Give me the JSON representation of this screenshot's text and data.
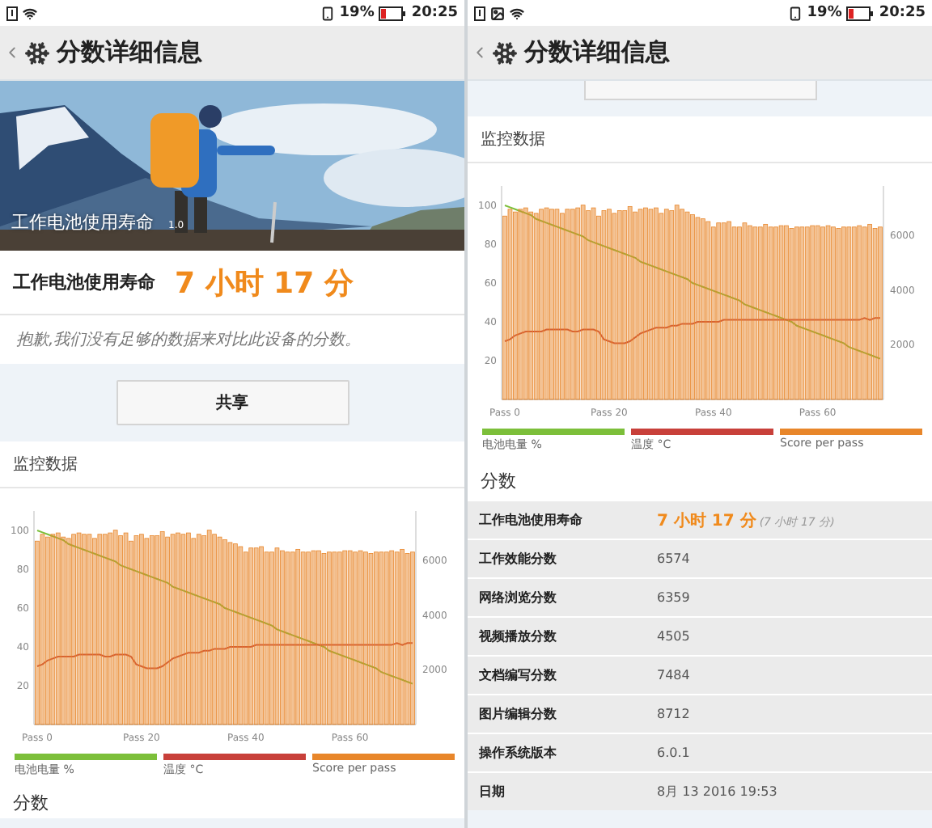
{
  "screens": [
    {
      "status_bar": {
        "battery": "19%",
        "time": "20:25",
        "gallery_notification": false
      },
      "title": "分数详细信息",
      "sections": [
        {
          "kind": "banner",
          "label": "工作电池使用寿命",
          "version": "1.0"
        },
        {
          "kind": "result",
          "label": "工作电池使用寿命",
          "value": "7 小时 17 分"
        },
        {
          "kind": "notice",
          "text": "抱歉,我们没有足够的数据来对比此设备的分数。"
        },
        {
          "kind": "share",
          "button": "共享"
        },
        {
          "kind": "monitor",
          "title": "监控数据",
          "chart_data": {
            "type": "bar",
            "categories": [
              "Pass 0",
              null,
              null,
              null,
              null,
              null,
              null,
              null,
              null,
              null,
              null,
              null,
              null,
              null,
              null,
              null,
              null,
              null,
              null,
              null,
              "Pass 20",
              null,
              null,
              null,
              null,
              null,
              null,
              null,
              null,
              null,
              null,
              null,
              null,
              null,
              null,
              null,
              null,
              null,
              null,
              null,
              "Pass 40",
              null,
              null,
              null,
              null,
              null,
              null,
              null,
              null,
              null,
              null,
              null,
              null,
              null,
              null,
              null,
              null,
              null,
              null,
              null,
              "Pass 60",
              null,
              null,
              null,
              null,
              null,
              null,
              null,
              null,
              null,
              null,
              null,
              null
            ],
            "ylim": [
              0,
              110
            ],
            "yticks": [
              20,
              40,
              60,
              80,
              100
            ],
            "y2lim": [
              0,
              7800
            ],
            "y2ticks": [
              2000,
              4000,
              6000
            ],
            "series": [
              {
                "name": "电池电量 %",
                "color": "#7cbf3a",
                "type": "line",
                "values": [
                  100,
                  99,
                  98,
                  97,
                  96,
                  95,
                  93,
                  92,
                  91,
                  90,
                  89,
                  88,
                  87,
                  86,
                  85,
                  84,
                  82,
                  81,
                  80,
                  79,
                  78,
                  77,
                  76,
                  75,
                  74,
                  73,
                  71,
                  70,
                  69,
                  68,
                  67,
                  66,
                  65,
                  64,
                  63,
                  62,
                  60,
                  59,
                  58,
                  57,
                  56,
                  55,
                  54,
                  53,
                  52,
                  51,
                  49,
                  48,
                  47,
                  46,
                  45,
                  44,
                  43,
                  42,
                  41,
                  40,
                  38,
                  37,
                  36,
                  35,
                  34,
                  33,
                  32,
                  31,
                  30,
                  29,
                  27,
                  26,
                  25,
                  24,
                  23,
                  22,
                  21
                ]
              },
              {
                "name": "温度 °C",
                "color": "#c8403a",
                "type": "line",
                "values": [
                  30,
                  31,
                  33,
                  34,
                  35,
                  35,
                  35,
                  35,
                  36,
                  36,
                  36,
                  36,
                  36,
                  35,
                  35,
                  36,
                  36,
                  36,
                  35,
                  31,
                  30,
                  29,
                  29,
                  29,
                  30,
                  32,
                  34,
                  35,
                  36,
                  37,
                  37,
                  37,
                  38,
                  38,
                  39,
                  39,
                  39,
                  40,
                  40,
                  40,
                  40,
                  40,
                  41,
                  41,
                  41,
                  41,
                  41,
                  41,
                  41,
                  41,
                  41,
                  41,
                  41,
                  41,
                  41,
                  41,
                  41,
                  41,
                  41,
                  41,
                  41,
                  41,
                  41,
                  41,
                  41,
                  41,
                  41,
                  41,
                  41,
                  42,
                  41,
                  42,
                  42
                ]
              },
              {
                "name": "Score per pass",
                "color": "#e8862a",
                "type": "bar",
                "axis": "y2",
                "values": [
                  6700,
                  6950,
                  6850,
                  6950,
                  7000,
                  6850,
                  6800,
                  6950,
                  7000,
                  6950,
                  6950,
                  6800,
                  6950,
                  6950,
                  7000,
                  7100,
                  6900,
                  7000,
                  6700,
                  6900,
                  6950,
                  6800,
                  6900,
                  6900,
                  7050,
                  6850,
                  6950,
                  7000,
                  6950,
                  7000,
                  6800,
                  6950,
                  6900,
                  7100,
                  6950,
                  6850,
                  6750,
                  6650,
                  6600,
                  6500,
                  6300,
                  6450,
                  6450,
                  6500,
                  6300,
                  6300,
                  6450,
                  6350,
                  6300,
                  6300,
                  6400,
                  6300,
                  6300,
                  6350,
                  6350,
                  6250,
                  6300,
                  6300,
                  6300,
                  6350,
                  6350,
                  6300,
                  6350,
                  6300,
                  6250,
                  6300,
                  6300,
                  6300,
                  6350,
                  6300,
                  6400,
                  6250,
                  6300
                ]
              }
            ]
          }
        },
        {
          "kind": "scores_heading",
          "text": "分数"
        }
      ]
    },
    {
      "status_bar": {
        "battery": "19%",
        "time": "20:25",
        "gallery_notification": true
      },
      "title": "分数详细信息",
      "sections": [
        {
          "kind": "partial_button"
        },
        {
          "kind": "monitor",
          "title": "监控数据",
          "chart_data": {
            "type": "bar",
            "categories": [
              "Pass 0",
              null,
              null,
              null,
              null,
              null,
              null,
              null,
              null,
              null,
              null,
              null,
              null,
              null,
              null,
              null,
              null,
              null,
              null,
              null,
              "Pass 20",
              null,
              null,
              null,
              null,
              null,
              null,
              null,
              null,
              null,
              null,
              null,
              null,
              null,
              null,
              null,
              null,
              null,
              null,
              null,
              "Pass 40",
              null,
              null,
              null,
              null,
              null,
              null,
              null,
              null,
              null,
              null,
              null,
              null,
              null,
              null,
              null,
              null,
              null,
              null,
              null,
              "Pass 60",
              null,
              null,
              null,
              null,
              null,
              null,
              null,
              null,
              null,
              null,
              null,
              null
            ],
            "ylim": [
              0,
              110
            ],
            "yticks": [
              20,
              40,
              60,
              80,
              100
            ],
            "y2lim": [
              0,
              7800
            ],
            "y2ticks": [
              2000,
              4000,
              6000
            ],
            "series": [
              {
                "name": "电池电量 %",
                "color": "#7cbf3a",
                "type": "line",
                "values": [
                  100,
                  99,
                  98,
                  97,
                  96,
                  95,
                  93,
                  92,
                  91,
                  90,
                  89,
                  88,
                  87,
                  86,
                  85,
                  84,
                  82,
                  81,
                  80,
                  79,
                  78,
                  77,
                  76,
                  75,
                  74,
                  73,
                  71,
                  70,
                  69,
                  68,
                  67,
                  66,
                  65,
                  64,
                  63,
                  62,
                  60,
                  59,
                  58,
                  57,
                  56,
                  55,
                  54,
                  53,
                  52,
                  51,
                  49,
                  48,
                  47,
                  46,
                  45,
                  44,
                  43,
                  42,
                  41,
                  40,
                  38,
                  37,
                  36,
                  35,
                  34,
                  33,
                  32,
                  31,
                  30,
                  29,
                  27,
                  26,
                  25,
                  24,
                  23,
                  22,
                  21
                ]
              },
              {
                "name": "温度 °C",
                "color": "#c8403a",
                "type": "line",
                "values": [
                  30,
                  31,
                  33,
                  34,
                  35,
                  35,
                  35,
                  35,
                  36,
                  36,
                  36,
                  36,
                  36,
                  35,
                  35,
                  36,
                  36,
                  36,
                  35,
                  31,
                  30,
                  29,
                  29,
                  29,
                  30,
                  32,
                  34,
                  35,
                  36,
                  37,
                  37,
                  37,
                  38,
                  38,
                  39,
                  39,
                  39,
                  40,
                  40,
                  40,
                  40,
                  40,
                  41,
                  41,
                  41,
                  41,
                  41,
                  41,
                  41,
                  41,
                  41,
                  41,
                  41,
                  41,
                  41,
                  41,
                  41,
                  41,
                  41,
                  41,
                  41,
                  41,
                  41,
                  41,
                  41,
                  41,
                  41,
                  41,
                  41,
                  42,
                  41,
                  42,
                  42
                ]
              },
              {
                "name": "Score per pass",
                "color": "#e8862a",
                "type": "bar",
                "axis": "y2",
                "values": [
                  6700,
                  6950,
                  6850,
                  6950,
                  7000,
                  6850,
                  6800,
                  6950,
                  7000,
                  6950,
                  6950,
                  6800,
                  6950,
                  6950,
                  7000,
                  7100,
                  6900,
                  7000,
                  6700,
                  6900,
                  6950,
                  6800,
                  6900,
                  6900,
                  7050,
                  6850,
                  6950,
                  7000,
                  6950,
                  7000,
                  6800,
                  6950,
                  6900,
                  7100,
                  6950,
                  6850,
                  6750,
                  6650,
                  6600,
                  6500,
                  6300,
                  6450,
                  6450,
                  6500,
                  6300,
                  6300,
                  6450,
                  6350,
                  6300,
                  6300,
                  6400,
                  6300,
                  6300,
                  6350,
                  6350,
                  6250,
                  6300,
                  6300,
                  6300,
                  6350,
                  6350,
                  6300,
                  6350,
                  6300,
                  6250,
                  6300,
                  6300,
                  6300,
                  6350,
                  6300,
                  6400,
                  6250,
                  6300
                ]
              }
            ]
          }
        },
        {
          "kind": "scores_heading",
          "text": "分数"
        },
        {
          "kind": "score_table",
          "rows": [
            {
              "kind": "result",
              "label": "工作电池使用寿命",
              "value": "7 小时 17 分",
              "note": "(7 小时 17 分)"
            },
            {
              "kind": "plain",
              "label": "工作效能分数",
              "value": "6574"
            },
            {
              "kind": "plain",
              "label": "网络浏览分数",
              "value": "6359"
            },
            {
              "kind": "plain",
              "label": "视频播放分数",
              "value": "4505"
            },
            {
              "kind": "plain",
              "label": "文档编写分数",
              "value": "7484"
            },
            {
              "kind": "plain",
              "label": "图片编辑分数",
              "value": "8712"
            },
            {
              "kind": "plain",
              "label": "操作系统版本",
              "value": "6.0.1"
            },
            {
              "kind": "plain",
              "label": "日期",
              "value": "8月 13 2016 19:53"
            }
          ]
        }
      ]
    }
  ]
}
